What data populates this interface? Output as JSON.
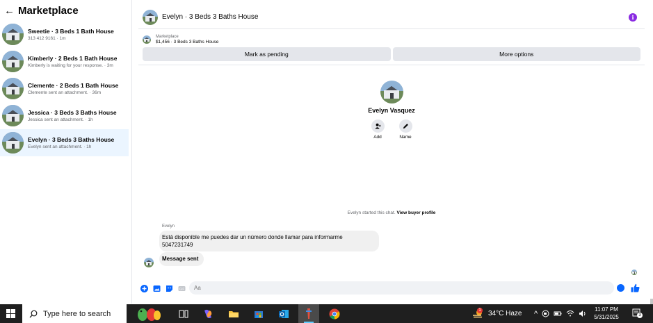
{
  "sidebar": {
    "title": "Marketplace",
    "conversations": [
      {
        "title": "Sweetie · 3 Beds 1 Bath House",
        "subtitle": "313 412 9161 · 1m"
      },
      {
        "title": "Kimberly · 2 Beds 1 Bath House",
        "subtitle": "Kimberly is waiting for your response. · 3m"
      },
      {
        "title": "Clemente · 2 Beds 1 Bath House",
        "subtitle": "Clemente sent an attachment. · 36m"
      },
      {
        "title": "Jessica · 3 Beds 3 Baths House",
        "subtitle": "Jessica sent an attachment. · 1h"
      },
      {
        "title": "Evelyn · 3 Beds 3 Baths House",
        "subtitle": "Evelyn sent an attachment. · 1h"
      }
    ]
  },
  "chat": {
    "title": "Evelyn · 3 Beds 3 Baths House",
    "marketplace_label": "Marketplace",
    "listing": "$1,456 · 3 Beds 3 Baths House",
    "mark_pending": "Mark as pending",
    "more_options": "More options",
    "profile_name": "Evelyn Vasquez",
    "add_label": "Add",
    "name_label": "Name",
    "started_text": "Evelyn started this chat.",
    "view_profile": "View buyer profile",
    "sender_name": "Evelyn",
    "message_1_line_1": "Está disponible me puedes dar un número donde llamar para informarme",
    "message_1_line_2": "5047231749",
    "message_2": "Message sent",
    "composer_placeholder": "Aa"
  },
  "taskbar": {
    "search_placeholder": "Type here to search",
    "weather": "34°C  Haze",
    "weather_badge": "1",
    "time": "11:07 PM",
    "date": "5/31/2025",
    "notification_count": "3"
  },
  "colors": {
    "accent": "#0866ff",
    "info_icon": "#8a2be2",
    "active_conversation": "#ebf5ff"
  }
}
